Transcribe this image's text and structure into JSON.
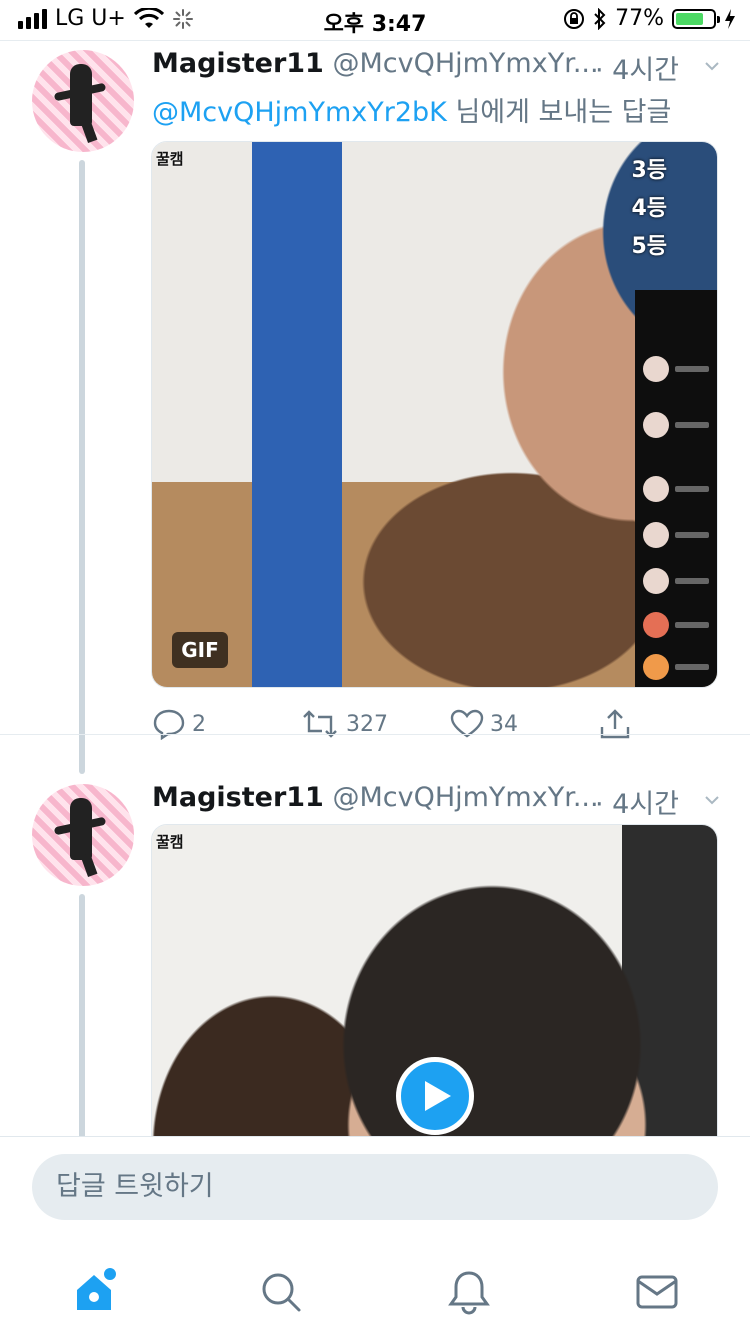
{
  "status_bar": {
    "carrier": "LG U+",
    "time": "오후 3:47",
    "battery_percent": "77%",
    "battery_level": 0.77,
    "battery_color": "#4cd964",
    "icons": [
      "signal-icon",
      "wifi-icon",
      "activity-spinner-icon",
      "orientation-lock-icon",
      "bluetooth-icon",
      "battery-icon",
      "charging-icon"
    ]
  },
  "tweets": [
    {
      "name": "Magister11",
      "handle": "@McvQHjmYmxYr...",
      "time": "· 4시간",
      "reply_to_mention": "@McvQHjmYmxYr2bK",
      "reply_to_suffix": " 님에게 보내는 답글",
      "media_watermark": "꿀캠",
      "media_badge": "GIF",
      "overlay_ranks": [
        "3등",
        "4등",
        "5등"
      ],
      "replies": "2",
      "retweets": "327",
      "likes": "34"
    },
    {
      "name": "Magister11",
      "handle": "@McvQHjmYmxYr...",
      "time": "· 4시간",
      "media_watermark": "꿀캠"
    }
  ],
  "reply_bar": {
    "placeholder": "답글 트윗하기"
  },
  "tab_bar": {
    "items": [
      "home-icon",
      "search-icon",
      "notifications-icon",
      "messages-icon"
    ],
    "accent_color": "#1da1f2"
  }
}
